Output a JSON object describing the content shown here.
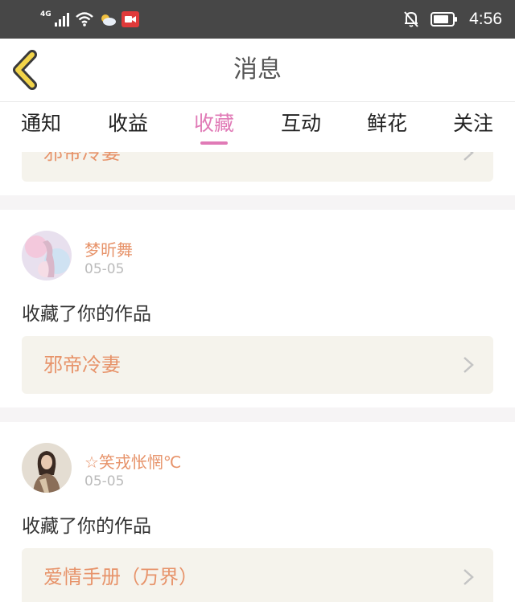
{
  "status_bar": {
    "network": "4G",
    "time": "4:56"
  },
  "header": {
    "title": "消息"
  },
  "tabs": [
    {
      "label": "通知"
    },
    {
      "label": "收益"
    },
    {
      "label": "收藏",
      "active": true
    },
    {
      "label": "互动"
    },
    {
      "label": "鲜花"
    },
    {
      "label": "关注"
    }
  ],
  "feed": {
    "partial_item": {
      "work_title": "邪帝冷妻"
    },
    "items": [
      {
        "username": "梦昕舞",
        "date": "05-05",
        "action": "收藏了你的作品",
        "work_title": "邪帝冷妻"
      },
      {
        "username": "☆笑戎怅惘℃",
        "date": "05-05",
        "action": "收藏了你的作品",
        "work_title": "爱情手册（万界）"
      }
    ]
  },
  "colors": {
    "accent": "#e07ab6",
    "work_title": "#e7936a",
    "status_bar": "#474747"
  }
}
